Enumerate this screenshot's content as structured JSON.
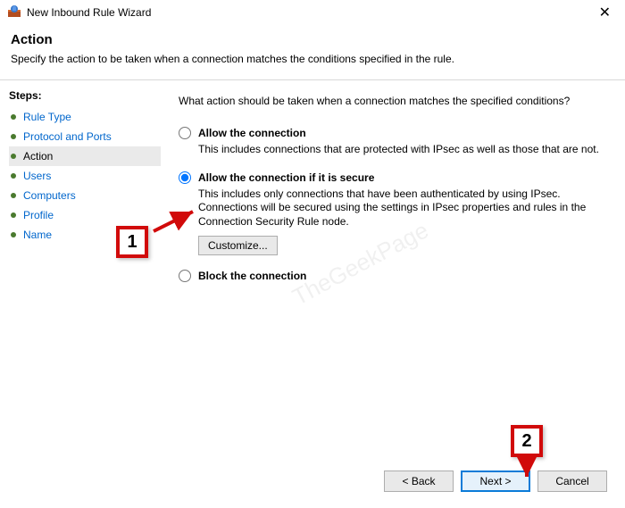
{
  "titlebar": {
    "title": "New Inbound Rule Wizard"
  },
  "header": {
    "title": "Action",
    "subtitle": "Specify the action to be taken when a connection matches the conditions specified in the rule."
  },
  "sidebar": {
    "label": "Steps:",
    "items": [
      {
        "label": "Rule Type",
        "state": "link"
      },
      {
        "label": "Protocol and Ports",
        "state": "link"
      },
      {
        "label": "Action",
        "state": "current"
      },
      {
        "label": "Users",
        "state": "link"
      },
      {
        "label": "Computers",
        "state": "link"
      },
      {
        "label": "Profile",
        "state": "link"
      },
      {
        "label": "Name",
        "state": "link"
      }
    ]
  },
  "content": {
    "question": "What action should be taken when a connection matches the specified conditions?",
    "options": [
      {
        "label": "Allow the connection",
        "desc": "This includes connections that are protected with IPsec as well as those that are not.",
        "checked": false
      },
      {
        "label": "Allow the connection if it is secure",
        "desc": "This includes only connections that have been authenticated by using IPsec.  Connections will be secured using the settings in IPsec properties and rules in the Connection Security Rule node.",
        "checked": true,
        "customize": "Customize..."
      },
      {
        "label": "Block the connection",
        "desc": "",
        "checked": false
      }
    ]
  },
  "footer": {
    "back": "< Back",
    "next": "Next >",
    "cancel": "Cancel"
  },
  "annotations": {
    "one": "1",
    "two": "2"
  },
  "watermark": "TheGeekPage"
}
